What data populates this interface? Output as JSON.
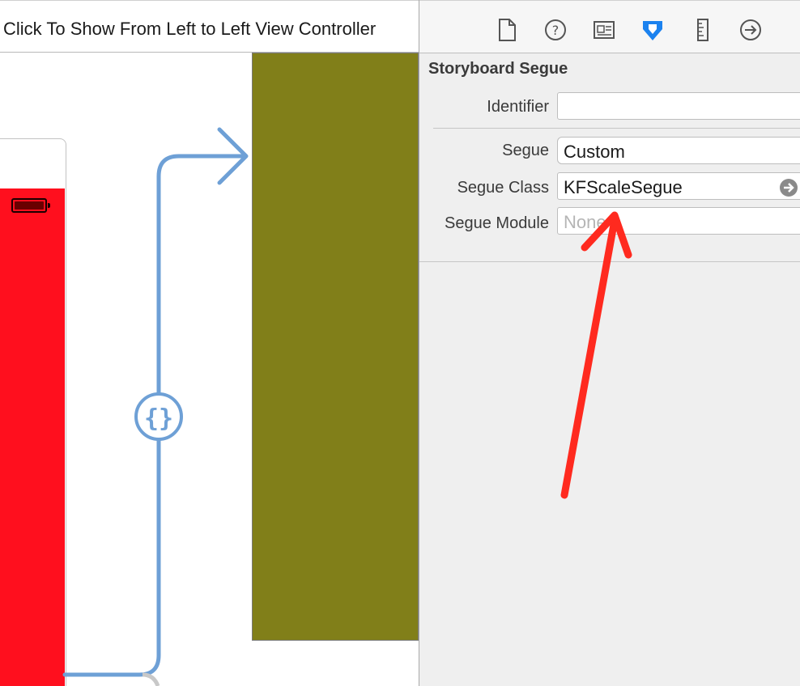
{
  "window": {
    "title": "Click To Show From Left to Left View Controller"
  },
  "canvas": {
    "source_scene_color": "#ff0f1e",
    "destination_scene_color": "#817f19",
    "segue_line_color": "#6ea0d6",
    "segue_badge_icon": "curly-braces-icon"
  },
  "inspector": {
    "toolbar_icons": [
      "file-icon",
      "help-icon",
      "identity-card-icon",
      "attributes-icon",
      "ruler-icon",
      "connections-icon"
    ],
    "selected_tool": "attributes-icon",
    "section_title": "Storyboard Segue",
    "fields": {
      "identifier": {
        "label": "Identifier",
        "value": ""
      },
      "segue": {
        "label": "Segue",
        "value": "Custom"
      },
      "segue_class": {
        "label": "Segue Class",
        "value": "KFScaleSegue"
      },
      "segue_module": {
        "label": "Segue Module",
        "placeholder": "None"
      }
    }
  },
  "annotation": {
    "color": "#ff2a1f",
    "kind": "red-arrow"
  }
}
